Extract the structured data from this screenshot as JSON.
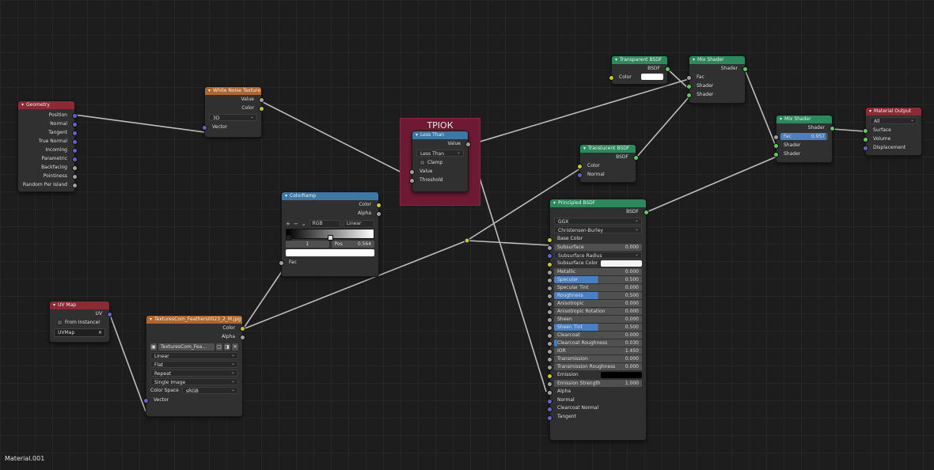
{
  "material_name": "Material.001",
  "frame": {
    "label": "ТРІОК"
  },
  "geometry": {
    "title": "Geometry",
    "outputs": [
      "Position",
      "Normal",
      "Tangent",
      "True Normal",
      "Incoming",
      "Parametric",
      "Backfacing",
      "Pointiness",
      "Random Per Island"
    ]
  },
  "white_noise": {
    "title": "White Noise Texture",
    "outputs": [
      "Value",
      "Color"
    ],
    "dimension": "3D",
    "input": "Vector"
  },
  "less_than": {
    "title": "Less Than",
    "output": "Value",
    "operation": "Less Than",
    "clamp": "Clamp",
    "inputs": [
      "Value",
      "Threshold"
    ]
  },
  "color_ramp": {
    "title": "ColorRamp",
    "outputs": [
      "Color",
      "Alpha"
    ],
    "plus": "+",
    "minus": "−",
    "chev": "⌄",
    "mode": "RGB",
    "interp": "Linear",
    "index": "1",
    "pos_label": "Pos",
    "pos_value": "0.564",
    "input": "Fac",
    "pos_fraction": 0.5
  },
  "uv_map": {
    "title": "UV Map",
    "output": "UV",
    "from_instancer": "From Instancer",
    "map": "UVMap",
    "clear": "✕"
  },
  "image_texture": {
    "title": "TexturesCom_Feathers0023_2_M.jpg",
    "outputs": [
      "Color",
      "Alpha"
    ],
    "image_name": "TexturesCom_Fea...",
    "buttons": [
      "▢",
      "◨",
      "✕"
    ],
    "interpolation": "Linear",
    "projection": "Flat",
    "extension": "Repeat",
    "source": "Single Image",
    "color_space_label": "Color Space",
    "color_space": "sRGB",
    "input": "Vector"
  },
  "transparent_bsdf": {
    "title": "Transparent BSDF",
    "output": "BSDF",
    "input": "Color",
    "color": "#ffffff"
  },
  "mix_shader_1": {
    "title": "Mix Shader",
    "output": "Shader",
    "inputs": [
      "Fac",
      "Shader",
      "Shader"
    ]
  },
  "translucent_bsdf": {
    "title": "Translucent BSDF",
    "output": "BSDF",
    "inputs": [
      "Color",
      "Normal"
    ]
  },
  "mix_shader_2": {
    "title": "Mix Shader",
    "output": "Shader",
    "fac_label": "Fac",
    "fac_value": "0.957",
    "fac_fraction": 0.957,
    "inputs": [
      "Shader",
      "Shader"
    ]
  },
  "material_output": {
    "title": "Material Output",
    "target": "All",
    "inputs": [
      "Surface",
      "Volume",
      "Displacement"
    ]
  },
  "principled": {
    "title": "Principled BSDF",
    "output": "BSDF",
    "distribution": "GGX",
    "subsurface_method": "Christensen-Burley",
    "base_color": "Base Color",
    "subsurface": {
      "label": "Subsurface",
      "value": "0.000"
    },
    "subsurface_radius": "Subsurface Radius",
    "subsurface_color": "Subsurface Color",
    "fields": [
      {
        "label": "Metallic",
        "value": "0.000",
        "fraction": 0
      },
      {
        "label": "Specular",
        "value": "0.500",
        "fraction": 0.5
      },
      {
        "label": "Specular Tint",
        "value": "0.000",
        "fraction": 0
      },
      {
        "label": "Roughness",
        "value": "0.500",
        "fraction": 0.5
      },
      {
        "label": "Anisotropic",
        "value": "0.000",
        "fraction": 0
      },
      {
        "label": "Anisotropic Rotation",
        "value": "0.000",
        "fraction": 0
      },
      {
        "label": "Sheen",
        "value": "0.000",
        "fraction": 0
      },
      {
        "label": "Sheen Tint",
        "value": "0.500",
        "fraction": 0.5
      },
      {
        "label": "Clearcoat",
        "value": "0.000",
        "fraction": 0
      },
      {
        "label": "Clearcoat Roughness",
        "value": "0.030",
        "fraction": 0.03
      },
      {
        "label": "IOR",
        "value": "1.450",
        "fraction": 0
      },
      {
        "label": "Transmission",
        "value": "0.000",
        "fraction": 0
      },
      {
        "label": "Transmission Roughness",
        "value": "0.000",
        "fraction": 0
      }
    ],
    "emission": "Emission",
    "emission_strength": {
      "label": "Emission Strength",
      "value": "1.000"
    },
    "inputs_bottom": [
      "Alpha",
      "Normal",
      "Clearcoat Normal",
      "Tangent"
    ]
  }
}
